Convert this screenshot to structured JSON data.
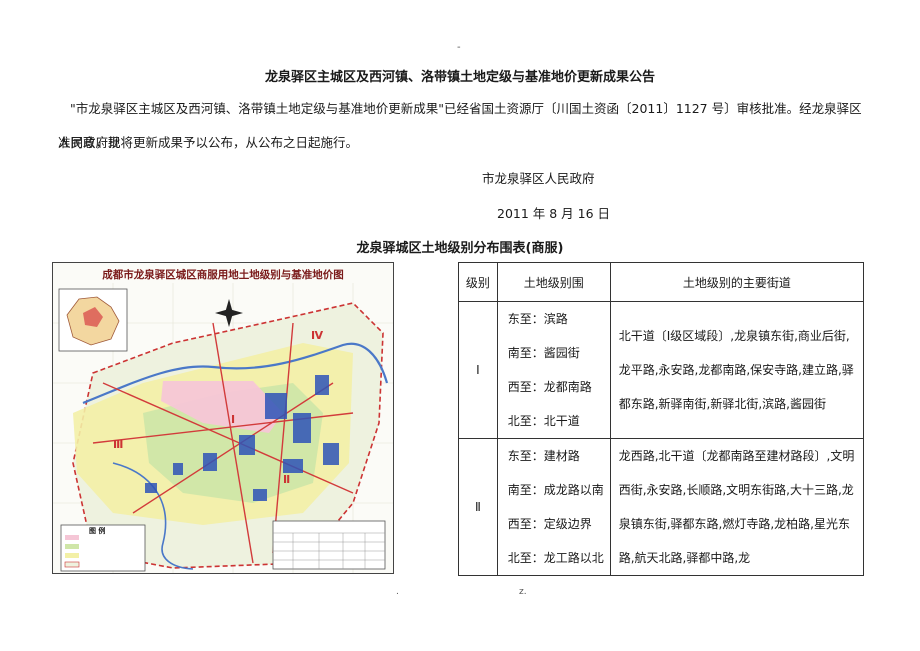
{
  "header": {
    "top_dot": "-"
  },
  "document": {
    "title": "龙泉驿区主城区及西河镇、洛带镇土地定级与基准地价更新成果公告",
    "paragraph_line1": "\"市龙泉驿区主城区及西河镇、洛带镇土地定级与基准地价更新成果\"已经省国土资源厅〔川国土资函〔2011〕1127 号〕审核批准。经龙泉驿区人民政府批",
    "paragraph_line2": "准同意，现将更新成果予以公布，从公布之日起施行。",
    "signer": "市龙泉驿区人民政府",
    "date": "2011 年 8 月 16 日",
    "table_title": "龙泉驿城区土地级别分布围表(商服)"
  },
  "map": {
    "title": "成都市龙泉驿区城区商服用地土地级别与基准地价图",
    "zone_labels": [
      "Ⅰ",
      "Ⅱ",
      "Ⅲ",
      "Ⅳ"
    ],
    "legend_title": "图 例"
  },
  "table": {
    "headers": [
      "级别",
      "土地级别围",
      "土地级别的主要街道"
    ],
    "rows": [
      {
        "level": "Ⅰ",
        "bounds": [
          "东至：滨路",
          "南至：酱园街",
          "西至：龙都南路",
          "北至：北干道"
        ],
        "streets": "北干道〔Ⅰ级区域段〕,龙泉镇东街,商业后街,龙平路,永安路,龙都南路,保安寺路,建立路,驿都东路,新驿南街,新驿北街,滨路,酱园街"
      },
      {
        "level": "Ⅱ",
        "bounds": [
          "东至：建材路",
          "南至：成龙路以南",
          "西至：定级边界",
          "北至：龙工路以北"
        ],
        "streets": "龙西路,北干道〔龙都南路至建材路段〕,文明西街,永安路,长顺路,文明东街路,大十三路,龙泉镇东街,驿都东路,燃灯寺路,龙柏路,星光东路,航天北路,驿都中路,龙"
      }
    ]
  },
  "footer": {
    "dot_left": ".",
    "dot_right": "z."
  },
  "colors": {
    "title_red": "#7a1a1a",
    "zone_yellow": "#f3f0a6",
    "zone_green": "#cfe6a8",
    "zone_pink": "#f5c6d6",
    "road_red": "#d23b3b",
    "river_blue": "#4a78c8"
  }
}
